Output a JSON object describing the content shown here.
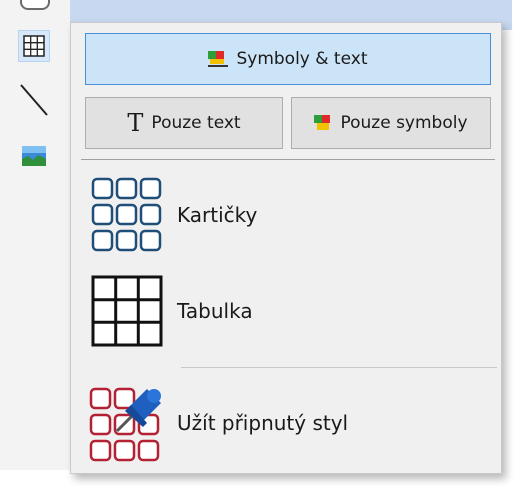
{
  "popup": {
    "primary_button_label": "Symboly & text",
    "text_only_label": "Pouze text",
    "text_only_glyph": "T",
    "symbols_only_label": "Pouze symboly",
    "items": [
      {
        "label": "Kartičky",
        "icon": "cards-grid-icon"
      },
      {
        "label": "Tabulka",
        "icon": "table-grid-icon"
      },
      {
        "label": "Užít připnutý styl",
        "icon": "pinned-style-icon"
      }
    ]
  },
  "toolbar": {
    "items": [
      "rounded-shape-icon",
      "grid-icon",
      "line-icon",
      "image-icon"
    ]
  },
  "colors": {
    "primary_fill": "#cce4f7",
    "primary_border": "#4a90d9",
    "card_blue": "#1f4e79",
    "card_red": "#b22234",
    "pin_blue": "#1e5fbf"
  }
}
